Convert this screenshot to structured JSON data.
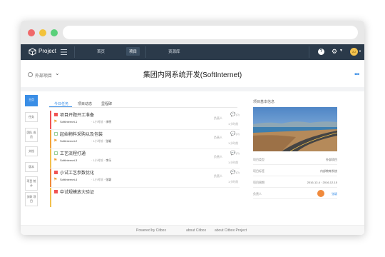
{
  "app": {
    "logo_text": "Project"
  },
  "nav": {
    "items": [
      {
        "label": "首页"
      },
      {
        "label": "项目"
      },
      {
        "label": "资源库"
      }
    ],
    "help_label": "?",
    "user_initials": "AJ"
  },
  "header": {
    "project_scope": "外部项目",
    "title": "集团内网系统开发(SoftInternet)"
  },
  "side_tabs": [
    {
      "label": "主页"
    },
    {
      "label": "任务"
    },
    {
      "label": "团队 成员"
    },
    {
      "label": "文档"
    },
    {
      "label": "版本"
    },
    {
      "label": "项目 统计"
    },
    {
      "label": "关联 项目"
    }
  ],
  "center_tabs": [
    {
      "label": "今日任务"
    },
    {
      "label": "项目动态"
    },
    {
      "label": "里程碑"
    }
  ],
  "tasks": [
    {
      "title": "项目开题开工准备",
      "project": "SoftInternet-1",
      "meta_time": "· 1小时前 · ",
      "owner": "李明",
      "comments": "(0)",
      "assignee": "负责人",
      "time": "1小时前",
      "accent": "#f05454",
      "check": "red"
    },
    {
      "title": "起始物料采购以及包装",
      "project": "SoftInternet-2",
      "meta_time": "· 1小时前 · ",
      "owner": "张颖",
      "comments": "(0)",
      "assignee": "负责人",
      "time": "1小时前",
      "accent": "#f2a33a",
      "check": "green"
    },
    {
      "title": "工艺流程打通",
      "project": "SoftInternet-3",
      "meta_time": "· 1小时前 · ",
      "owner": "李乐",
      "comments": "(0)",
      "assignee": "负责人",
      "time": "1小时前",
      "accent": "#f2c14e",
      "check": "green"
    },
    {
      "title": "小试工艺参数优化",
      "project": "SoftInternet-4",
      "meta_time": "· 1小时前 · ",
      "owner": "张颖",
      "comments": "(0)",
      "assignee": "负责人",
      "time": "1小时前",
      "accent": "#f08a3c",
      "check": "red"
    },
    {
      "title": "中试规模放大验证",
      "project": "",
      "meta_time": "",
      "owner": "",
      "comments": "",
      "assignee": "",
      "time": "",
      "accent": "#f2c14e",
      "check": "red"
    }
  ],
  "right_panel": {
    "title": "项目基本信息",
    "rows": [
      {
        "label": "项目类型",
        "value": "外部项目"
      },
      {
        "label": "项目标签",
        "value": "内部教育系统"
      },
      {
        "label": "项目周期",
        "value": "2016-12-4 · 2016-12-15"
      },
      {
        "label": "负责人",
        "value": "张颖"
      }
    ]
  },
  "footer": {
    "powered": "Powered by Citbox",
    "about1": "about Citbox",
    "about2": "about Citbox Project"
  },
  "colors": {
    "nav_bg": "#2b3a4a",
    "accent": "#3a8ee6"
  }
}
